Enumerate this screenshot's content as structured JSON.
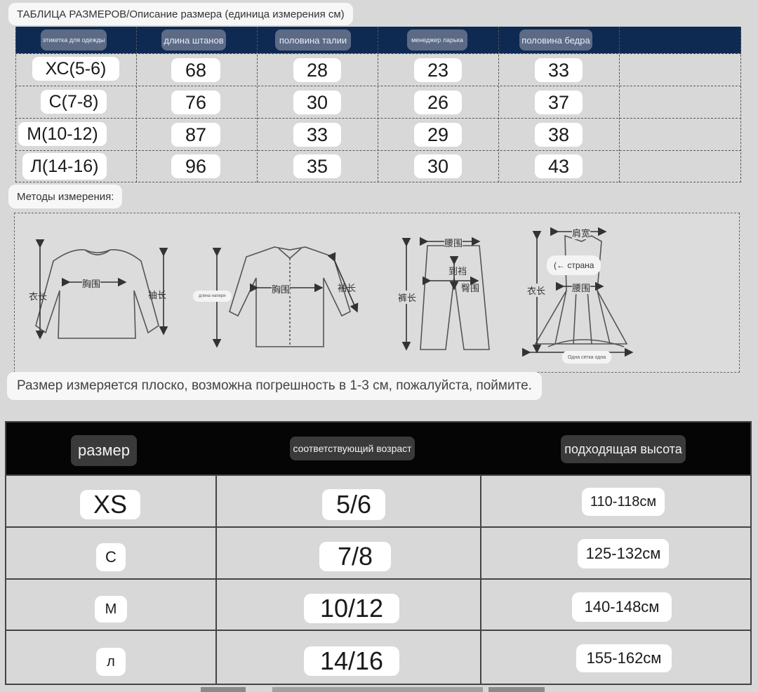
{
  "title": "ТАБЛИЦА РАЗМЕРОВ/Описание размера (единица измерения см)",
  "size_table": {
    "headers": [
      "этикетка для одежды",
      "длина штанов",
      "половина талии",
      "менеджер ларька",
      "половина бедра",
      ""
    ],
    "rows": [
      {
        "label": "ХС(5-6)",
        "values": [
          "68",
          "28",
          "23",
          "33"
        ]
      },
      {
        "label": "С(7-8)",
        "values": [
          "76",
          "30",
          "26",
          "37"
        ]
      },
      {
        "label": "М(10-12)",
        "values": [
          "87",
          "33",
          "29",
          "38"
        ]
      },
      {
        "label": "Л(14-16)",
        "values": [
          "96",
          "35",
          "30",
          "43"
        ]
      }
    ]
  },
  "methods_label": "Методы измерения:",
  "diagram": {
    "sweater": {
      "left": "衣长",
      "chest": "胸围",
      "right": "袖长"
    },
    "shirt": {
      "overlay": "длина напери",
      "chest": "胸围",
      "sleeve": "袖长"
    },
    "pants": {
      "waist": "腰围",
      "crotch": "到裆",
      "hip": "臀围",
      "length": "裤长"
    },
    "dress": {
      "shoulder": "肩宽",
      "chest": "(← страна",
      "length": "衣长",
      "waist": "腰围",
      "hem": "Одна сетка одна"
    }
  },
  "note": "Размер измеряется плоско, возможна погрешность в 1-3 см, пожалуйста, поймите.",
  "age_table": {
    "headers": [
      "размер",
      "соответствующий возраст",
      "подходящая высота"
    ],
    "rows": [
      {
        "size": "XS",
        "age": "5/6",
        "height": "110-118см"
      },
      {
        "size": "С",
        "age": "7/8",
        "height": "125-132см"
      },
      {
        "size": "М",
        "age": "10/12",
        "height": "140-148см"
      },
      {
        "size": "л",
        "age": "14/16",
        "height": "155-162см"
      }
    ]
  }
}
